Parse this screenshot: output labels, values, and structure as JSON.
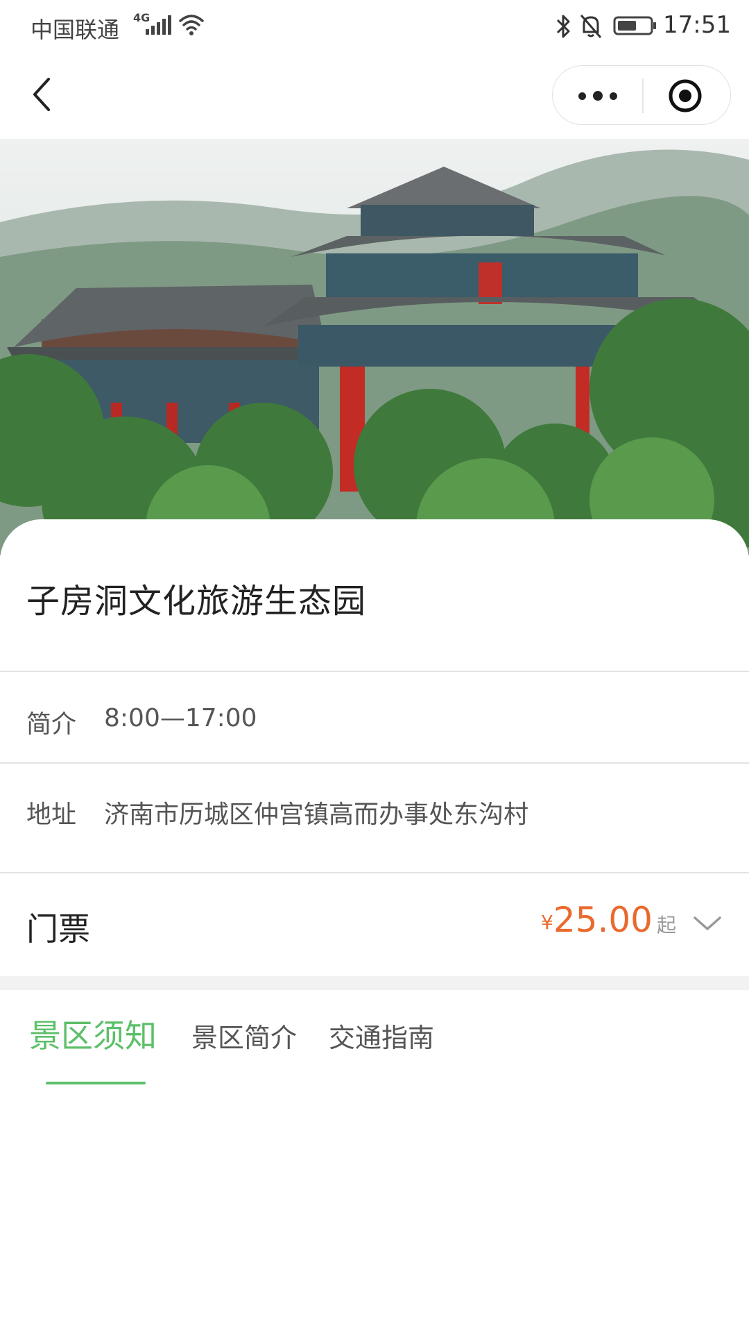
{
  "status_bar": {
    "carrier": "中国联通",
    "network": "4G",
    "time": "17:51",
    "icons": [
      "signal-icon",
      "wifi-icon",
      "bluetooth-icon",
      "mute-icon",
      "battery-icon"
    ]
  },
  "nav": {
    "back_icon": "back-chevron-icon",
    "more_icon": "more-dots-icon",
    "close_icon": "target-close-icon"
  },
  "attraction": {
    "name": "子房洞文化旅游生态园",
    "intro_label": "简介",
    "intro_value": "8:00—17:00",
    "address_label": "地址",
    "address_value": "济南市历城区仲宫镇高而办事处东沟村"
  },
  "ticket": {
    "label": "门票",
    "currency": "¥",
    "price": "25.00",
    "suffix": "起",
    "expand_icon": "chevron-down-icon"
  },
  "tabs": [
    {
      "label": "景区须知",
      "active": true
    },
    {
      "label": "景区简介",
      "active": false
    },
    {
      "label": "交通指南",
      "active": false
    }
  ],
  "colors": {
    "accent_green": "#5dbf6a",
    "price_orange": "#e96a2e",
    "divider": "#e3e3e3",
    "band": "#f2f2f2"
  }
}
